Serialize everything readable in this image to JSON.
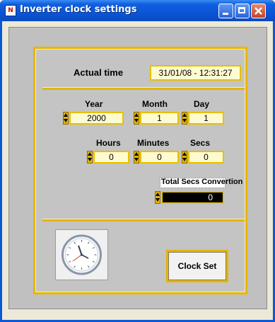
{
  "window": {
    "title": "Inverter clock settings"
  },
  "actual_time": {
    "label": "Actual time",
    "value": "31/01/08 - 12:31:27"
  },
  "date": {
    "year": {
      "label": "Year",
      "value": "2000"
    },
    "month": {
      "label": "Month",
      "value": "1"
    },
    "day": {
      "label": "Day",
      "value": "1"
    }
  },
  "time": {
    "hours": {
      "label": "Hours",
      "value": "0"
    },
    "minutes": {
      "label": "Minutes",
      "value": "0"
    },
    "secs": {
      "label": "Secs",
      "value": "0"
    }
  },
  "total_secs": {
    "label": "Total Secs Convertion",
    "value": "0"
  },
  "buttons": {
    "clock_set": "Clock Set"
  },
  "colors": {
    "accent": "#e6b400",
    "field_bg": "#fffbd0",
    "panel_bg": "#c4c4c4",
    "titlebar": "#0b55d6"
  },
  "icons": [
    "app-icon",
    "minimize-icon",
    "maximize-icon",
    "close-icon",
    "clock-icon",
    "spinner-icon"
  ]
}
